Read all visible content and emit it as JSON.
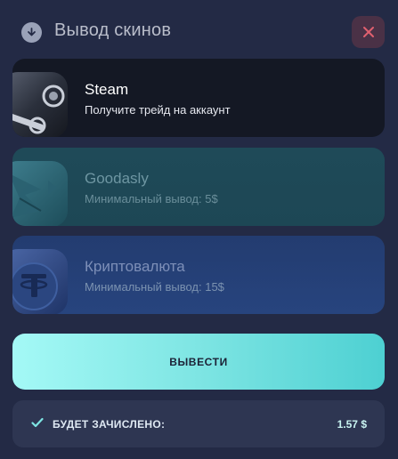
{
  "header": {
    "title": "Вывод скинов",
    "icon": "download-icon",
    "close_icon": "close-icon"
  },
  "methods": [
    {
      "id": "steam",
      "title": "Steam",
      "subtitle": "Получите трейд на аккаунт",
      "icon": "steam-icon",
      "selected": true
    },
    {
      "id": "goodasly",
      "title": "Goodasly",
      "subtitle": "Минимальный вывод: 5$",
      "icon": "goodasly-icon",
      "selected": false
    },
    {
      "id": "crypto",
      "title": "Криптовалюта",
      "subtitle": "Минимальный вывод: 15$",
      "icon": "tether-icon",
      "selected": false
    }
  ],
  "action": {
    "label": "ВЫВЕСТИ"
  },
  "credit": {
    "label": "БУДЕТ ЗАЧИСЛЕНО:",
    "value": "1.57 $",
    "icon": "check-icon"
  },
  "colors": {
    "accent": "#7ee5e3",
    "background": "#232a45",
    "close_accent": "#e0606f"
  }
}
